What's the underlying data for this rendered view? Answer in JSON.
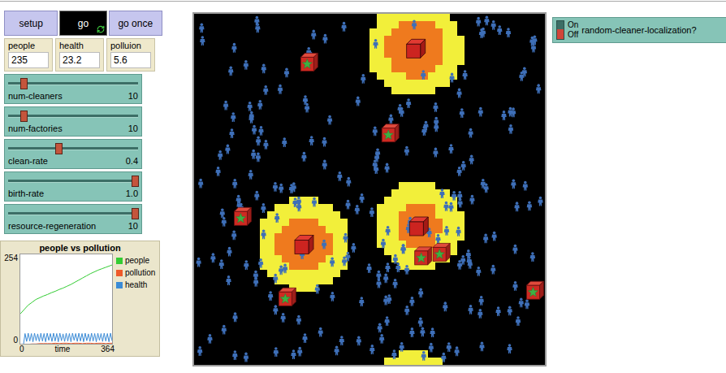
{
  "buttons": [
    {
      "label": "setup",
      "forever": false,
      "pressed": false
    },
    {
      "label": "go",
      "forever": true,
      "pressed": true
    },
    {
      "label": "go once",
      "forever": false,
      "pressed": false
    }
  ],
  "monitors": [
    {
      "label": "people",
      "value": "235"
    },
    {
      "label": "health",
      "value": "23.2"
    },
    {
      "label": "polluion",
      "value": "5.6"
    }
  ],
  "sliders": [
    {
      "label": "num-cleaners",
      "value": "10",
      "level": 0.1
    },
    {
      "label": "num-factories",
      "value": "10",
      "level": 0.1
    },
    {
      "label": "clean-rate",
      "value": "0.4",
      "level": 0.38
    },
    {
      "label": "birth-rate",
      "value": "1.0",
      "level": 1.0
    },
    {
      "label": "resource-regeneration",
      "value": "10",
      "level": 1.0
    }
  ],
  "switch": {
    "on_label": "On",
    "off_label": "Off",
    "label": "random-cleaner-localization?",
    "on": false
  },
  "plot": {
    "title": "people vs pollution",
    "y_ticks": [
      "254",
      "0"
    ],
    "x_ticks": [
      "0",
      "364"
    ],
    "x_label": "time",
    "y_min": 0,
    "y_max": 254,
    "series": [
      {
        "name": "people",
        "color": "#33cc33",
        "values": [
          88,
          100,
          112,
          120,
          128,
          133,
          138,
          142,
          147,
          151,
          156,
          160,
          165,
          170,
          176,
          182,
          188,
          194,
          200,
          205,
          210,
          214,
          218,
          222,
          226
        ]
      },
      {
        "name": "pollution",
        "color": "#ee5a2a",
        "values": [
          0,
          2,
          3,
          4,
          4,
          5,
          5,
          5,
          5,
          6,
          5,
          6,
          6,
          5,
          6,
          6,
          5,
          6,
          6,
          5,
          6,
          6,
          5,
          6,
          6
        ]
      },
      {
        "name": "health",
        "color": "#3b8bd6",
        "values": [
          0,
          0,
          0,
          33,
          11,
          34,
          12,
          33,
          10,
          34,
          13,
          32,
          11,
          34,
          12,
          33,
          10,
          34,
          14,
          33,
          11,
          34,
          12,
          33,
          10,
          34,
          13,
          32,
          11,
          34,
          12,
          33,
          10,
          34,
          14,
          33,
          11,
          34,
          12,
          33,
          10,
          34,
          13,
          32,
          11,
          34,
          12,
          33,
          10,
          34,
          14,
          33,
          11,
          34,
          12,
          33,
          10,
          34,
          13,
          32
        ]
      }
    ]
  },
  "world": {
    "width": 48,
    "height": 48,
    "people": 235,
    "factories": [
      {
        "x": 30.3,
        "y": 4.7,
        "pollution_radius": 6.5,
        "core_radius": 4
      },
      {
        "x": 15,
        "y": 31.5,
        "pollution_radius": 6.3,
        "core_radius": 3.8
      },
      {
        "x": 30.7,
        "y": 29,
        "pollution_radius": 6,
        "core_radius": 3.1
      }
    ],
    "cleaners": [
      {
        "x": 15.7,
        "y": 6.6
      },
      {
        "x": 26.8,
        "y": 16.3
      },
      {
        "x": 6.6,
        "y": 27.7
      },
      {
        "x": 12.7,
        "y": 38.7
      },
      {
        "x": 31.3,
        "y": 33.1
      },
      {
        "x": 33.8,
        "y": 32.6
      },
      {
        "x": 46.6,
        "y": 37.8
      }
    ]
  }
}
